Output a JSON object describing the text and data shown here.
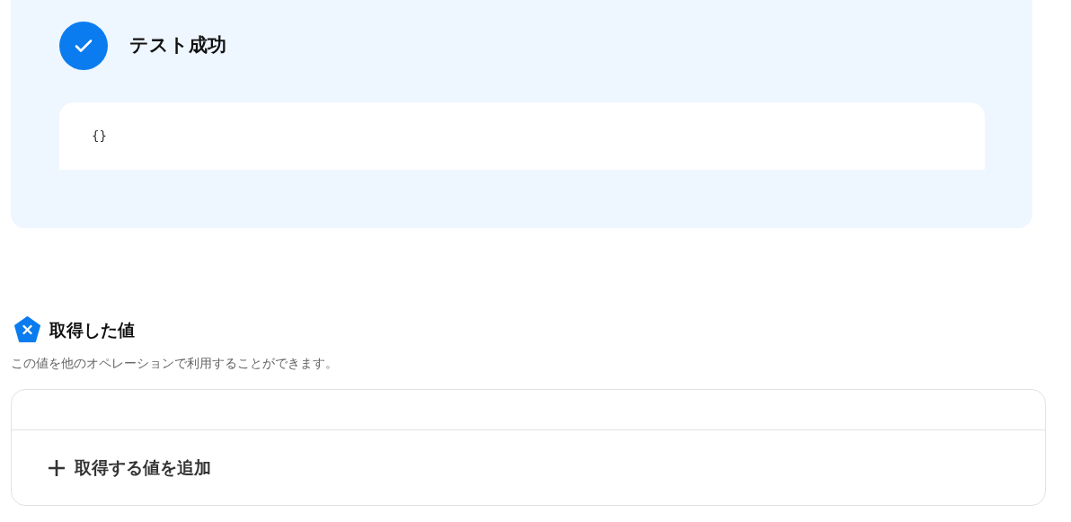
{
  "test_result": {
    "title": "テスト成功",
    "success": true,
    "output": "{}"
  },
  "acquired_values": {
    "title": "取得した値",
    "description": "この値を他のオペレーションで利用することができます。",
    "add_button": "取得する値を追加"
  }
}
